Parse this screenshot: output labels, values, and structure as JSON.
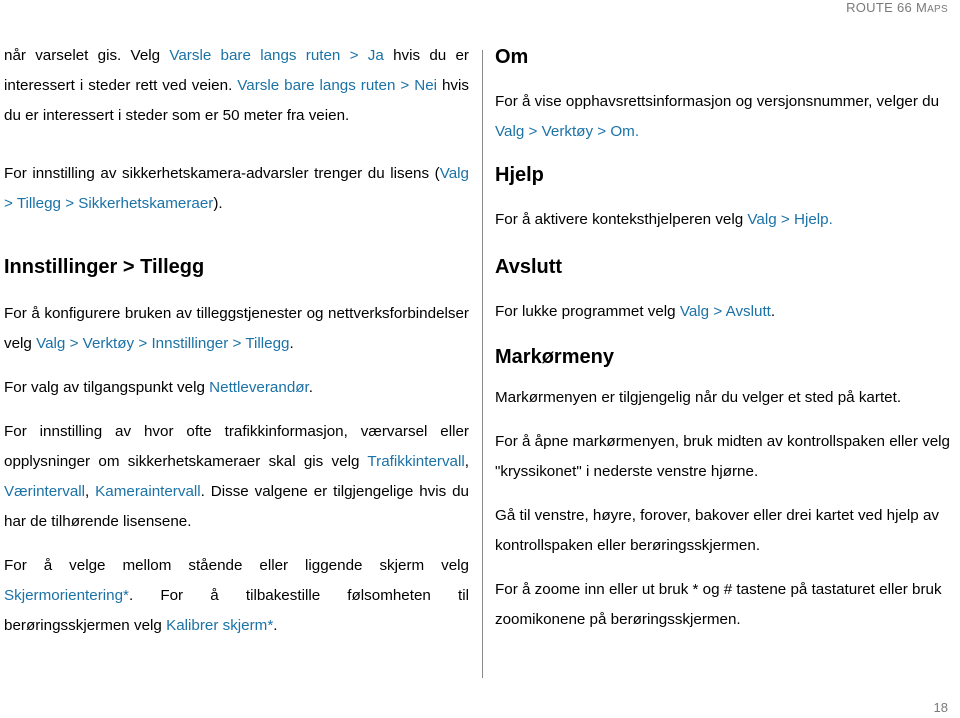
{
  "header": {
    "running_title_main": "ROUTE 66 M",
    "running_title_small": "APS"
  },
  "footer": {
    "page_number": "18"
  },
  "left": {
    "p1": {
      "t1": "når varselet gis. Velg ",
      "l1": "Varsle bare langs ruten > Ja",
      "t2": " hvis du er interessert i steder rett ved veien. ",
      "l2": "Varsle bare langs ruten > Nei",
      "t3": " hvis du er interessert i steder som er 50 meter fra veien."
    },
    "p2": {
      "t1": "For innstilling av sikkerhetskamera-advarsler trenger du lisens (",
      "l1": "Valg > Tillegg > Sikkerhetskameraer",
      "t2": ")."
    },
    "heading": "Innstillinger > Tillegg",
    "p3": {
      "t1": "For å konfigurere bruken av tilleggstjenester og nettverksforbindelser velg ",
      "l1": "Valg > Verktøy > Innstillinger > Tillegg",
      "t2": "."
    },
    "p4": {
      "t1": "For valg av tilgangspunkt velg ",
      "l1": "Nettleverandør",
      "t2": "."
    },
    "p5": {
      "t1": "For innstilling av hvor ofte trafikkinformasjon, værvarsel eller opplysninger om sikkerhetskameraer skal gis velg ",
      "l1": "Trafikkintervall",
      "t2": ", ",
      "l2": "Værintervall",
      "t3": ", ",
      "l3": "Kameraintervall",
      "t4": ". Disse valgene er tilgjengelige hvis du har de tilhørende lisensene."
    },
    "p6": {
      "t1": "For å velge mellom stående eller liggende skjerm velg ",
      "l1": "Skjermorientering*",
      "t2": ". For å tilbakestille følsomheten til berøringsskjermen velg ",
      "l2": "Kalibrer skjerm*",
      "t3": "."
    }
  },
  "right": {
    "om": {
      "heading": "Om",
      "t1": "For å vise opphavsrettsinformasjon og versjonsnummer, velger du ",
      "l1": "Valg > Verktøy > Om."
    },
    "hjelp": {
      "heading": "Hjelp",
      "t1": "For å aktivere konteksthjelperen velg ",
      "l1": "Valg > Hjelp."
    },
    "avslutt": {
      "heading": "Avslutt",
      "t1": "For lukke programmet velg ",
      "l1": "Valg > Avslutt",
      "t2": "."
    },
    "markormeny": {
      "heading": "Markørmeny",
      "p1": "Markørmenyen er tilgjengelig når du velger et sted på kartet.",
      "p2": "For å åpne markørmenyen, bruk midten av kontrollspaken eller velg \"kryssikonet\" i nederste venstre hjørne.",
      "p3": "Gå til venstre, høyre, forover, bakover eller drei kartet ved hjelp av kontrollspaken eller berøringsskjermen.",
      "p4": "For å zoome inn eller ut bruk * og # tastene på tastaturet eller bruk zoomikonene på berøringsskjermen."
    }
  },
  "colors": {
    "link": "#1b72a6",
    "text": "#000000",
    "header_gray": "#7a7a7a",
    "divider": "#8a8a8a"
  }
}
